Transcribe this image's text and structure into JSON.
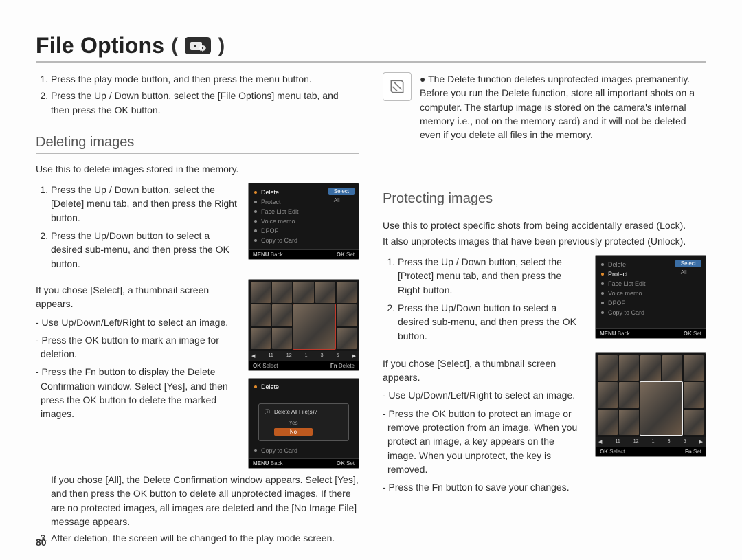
{
  "page_number": "80",
  "title": "File Options",
  "title_paren_open": "(",
  "title_paren_close": ")",
  "title_icon": "file-options",
  "intro_steps": [
    "Press the play mode button, and then press the menu button.",
    "Press the Up / Down button, select the [File Options] menu tab, and then press the OK button."
  ],
  "deleting": {
    "heading": "Deleting images",
    "intro": "Use this to delete images stored in the memory.",
    "steps12": [
      "Press the Up / Down button, select the [Delete] menu tab, and then press the Right button.",
      "Press the Up/Down button to select a desired sub-menu, and then press the OK button."
    ],
    "select_block": {
      "lead": "If you chose [Select], a thumbnail screen appears.",
      "bullets": [
        "Use Up/Down/Left/Right to select an image.",
        "Press the OK button to mark an image for deletion.",
        "Press the Fn button to display the Delete Confirmation window. Select [Yes], and then press the OK button to delete the marked images."
      ]
    },
    "all_block": "If you chose [All], the Delete Confirmation window appears. Select [Yes], and then press the OK button to delete all unprotected images. If there are no protected images, all images are deleted and the [No Image File] message appears.",
    "step3": "After deletion, the screen will be changed to the play mode screen.",
    "screen1": {
      "menu": [
        "Delete",
        "Protect",
        "Face List Edit",
        "Voice memo",
        "DPOF",
        "Copy to Card"
      ],
      "side": [
        "Select",
        "All"
      ],
      "status_left": "Back",
      "status_left_key": "MENU",
      "status_right": "Set",
      "status_right_key": "OK"
    },
    "screen_thumbs": {
      "strip": [
        "11",
        "12",
        "1",
        "3",
        "5"
      ],
      "status_left": "Select",
      "status_left_key": "OK",
      "status_right": "Delete",
      "status_right_key": "Fn"
    },
    "screen2": {
      "menu_top": "Delete",
      "dialog_title": "Delete All File(s)?",
      "yes": "Yes",
      "no": "No",
      "menu_bottom": "Copy to Card",
      "status_left": "Back",
      "status_left_key": "MENU",
      "status_right": "Set",
      "status_right_key": "OK"
    }
  },
  "note": {
    "text": "The Delete function deletes unprotected images premanentiy. Before you run the Delete function, store all important shots on a computer. The startup image is stored on the camera's internal memory i.e., not on the memory card) and it will not be deleted even if you delete all files in the memory."
  },
  "protecting": {
    "heading": "Protecting images",
    "intro1": "Use this to protect specific shots from being accidentally erased (Lock).",
    "intro2": "It also unprotects images that have been previously protected (Unlock).",
    "steps12": [
      "Press the Up / Down button, select the [Protect] menu tab, and then press the Right button.",
      "Press the Up/Down button to select a desired sub-menu, and then press the OK button."
    ],
    "select_block": {
      "lead": "If you chose [Select], a thumbnail screen appears.",
      "bullets": [
        "Use Up/Down/Left/Right to select an image.",
        "Press the OK button to protect an image or remove protection from an image. When you protect an image, a key appears on the image. When you unprotect, the key is removed.",
        "Press the Fn button to save your changes."
      ]
    },
    "screen1": {
      "menu": [
        "Delete",
        "Protect",
        "Face List Edit",
        "Voice memo",
        "DPOF",
        "Copy to Card"
      ],
      "side": [
        "Select",
        "All"
      ],
      "status_left": "Back",
      "status_left_key": "MENU",
      "status_right": "Set",
      "status_right_key": "OK"
    },
    "screen_thumbs": {
      "strip": [
        "11",
        "12",
        "1",
        "3",
        "5"
      ],
      "status_left": "Select",
      "status_left_key": "OK",
      "status_right": "Set",
      "status_right_key": "Fn"
    }
  }
}
